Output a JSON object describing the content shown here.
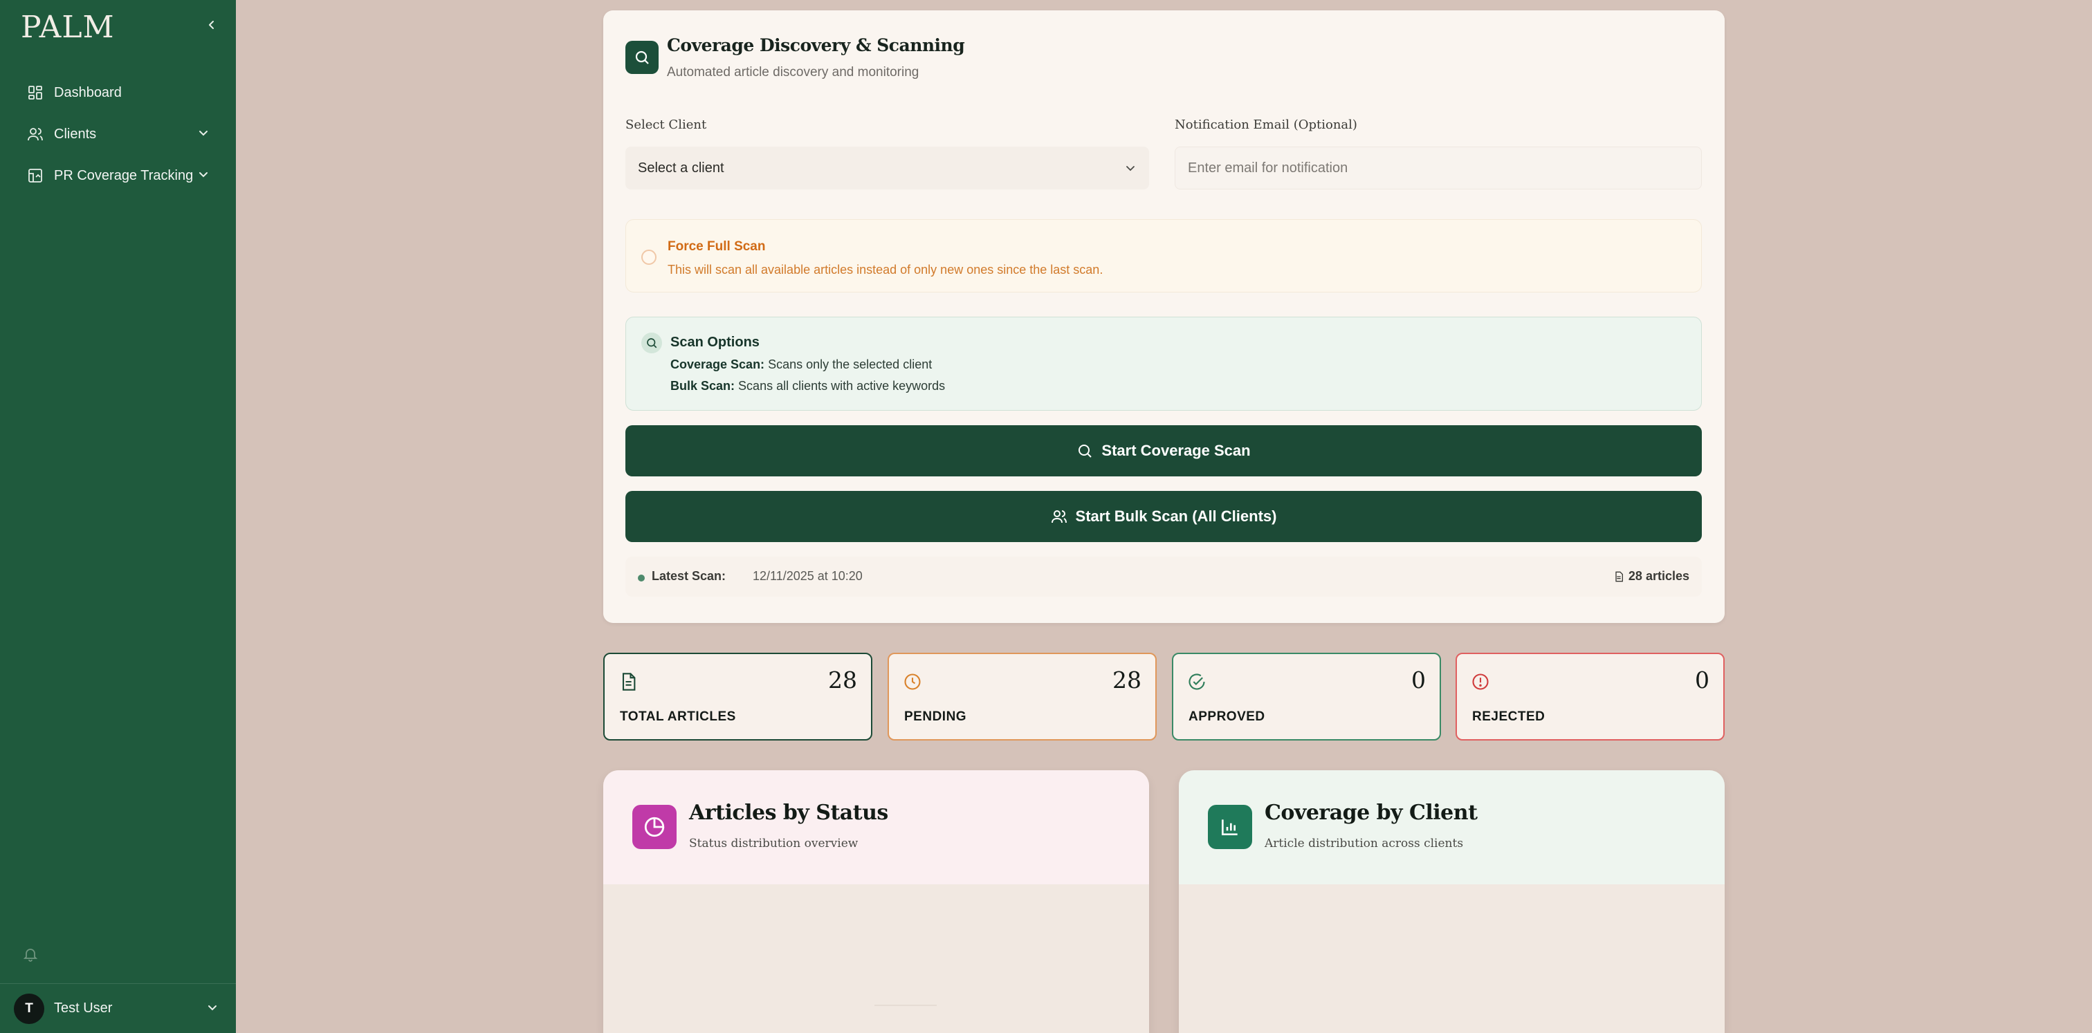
{
  "sidebar": {
    "logo": "PALM",
    "items": [
      {
        "label": "Dashboard",
        "icon": "dashboard-icon"
      },
      {
        "label": "Clients",
        "icon": "users-icon"
      },
      {
        "label": "PR Coverage Tracking",
        "icon": "coverage-icon"
      }
    ],
    "user": {
      "initial": "T",
      "name": "Test User"
    }
  },
  "scan_card": {
    "title": "Coverage Discovery & Scanning",
    "subtitle": "Automated article discovery and monitoring",
    "client_label": "Select Client",
    "client_value": "Select a client",
    "email_label": "Notification Email (Optional)",
    "email_placeholder": "Enter email for notification",
    "force_title": "Force Full Scan",
    "force_desc": "This will scan all available articles instead of only new ones since the last scan.",
    "options_title": "Scan Options",
    "options": [
      {
        "term": "Coverage Scan:",
        "desc": "Scans only the selected client"
      },
      {
        "term": "Bulk Scan:",
        "desc": "Scans all clients with active keywords"
      }
    ],
    "start_scan_label": "Start Coverage Scan",
    "bulk_scan_label": "Start Bulk Scan (All Clients)",
    "latest_label": "Latest Scan:",
    "latest_value": "12/11/2025 at 10:20",
    "latest_count": "28 articles"
  },
  "stats": [
    {
      "label": "TOTAL ARTICLES",
      "value": "28",
      "color": "#1c4a36"
    },
    {
      "label": "PENDING",
      "value": "28",
      "color": "#d9822b"
    },
    {
      "label": "APPROVED",
      "value": "0",
      "color": "#2e7d5a"
    },
    {
      "label": "REJECTED",
      "value": "0",
      "color": "#d03c3c"
    }
  ],
  "charts": [
    {
      "title": "Articles by Status",
      "subtitle": "Status distribution overview",
      "accent": "#c03aa8"
    },
    {
      "title": "Coverage by Client",
      "subtitle": "Article distribution across clients",
      "accent": "#1f7a5a"
    }
  ]
}
